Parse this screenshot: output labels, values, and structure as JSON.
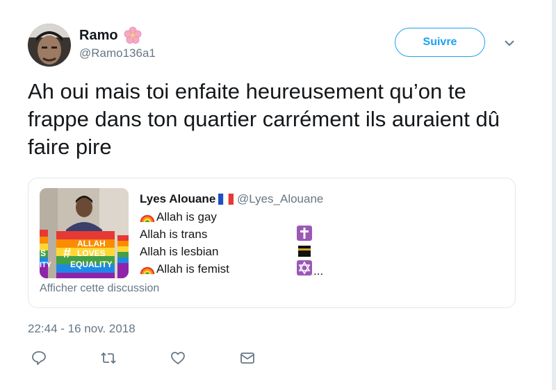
{
  "author": {
    "name": "Ramo",
    "handle": "@Ramo136a1",
    "name_emoji_icon": "cherry-blossom-icon"
  },
  "follow_button": {
    "label": "Suivre"
  },
  "tweet": {
    "text": "Ah oui mais toi enfaite heureusement qu’on te frappe dans ton quartier carrément ils auraient dû faire pire",
    "timestamp": "22:44 - 16 nov. 2018"
  },
  "quoted_tweet": {
    "name": "Lyes Alouane",
    "handle": "@Lyes_Alouane",
    "flag_icon": "french-flag-icon",
    "image_text": {
      "hash": "#",
      "line1": "ALLAH",
      "line2": "LOVES",
      "line3": "EQUALITY",
      "left_partial": "S",
      "left_partial2": "ITY"
    },
    "lines": [
      {
        "text": "Allah is gay",
        "leading_icon": "rainbow-icon",
        "trailing_icon": ""
      },
      {
        "text": "Allah is trans",
        "leading_icon": "",
        "trailing_icon": "latin-cross-icon"
      },
      {
        "text": "Allah is lesbian",
        "leading_icon": "",
        "trailing_icon": "kaaba-icon"
      },
      {
        "text": "Allah is femist",
        "leading_icon": "rainbow-icon",
        "trailing_icon": "star-of-david-icon"
      }
    ],
    "ellipsis": "...",
    "show_thread_label": "Afficher cette discussion"
  },
  "colors": {
    "accent": "#1da1f2",
    "secondary_text": "#657786",
    "border": "#e1e8ed",
    "emoji_purple": "#9b59b6"
  }
}
